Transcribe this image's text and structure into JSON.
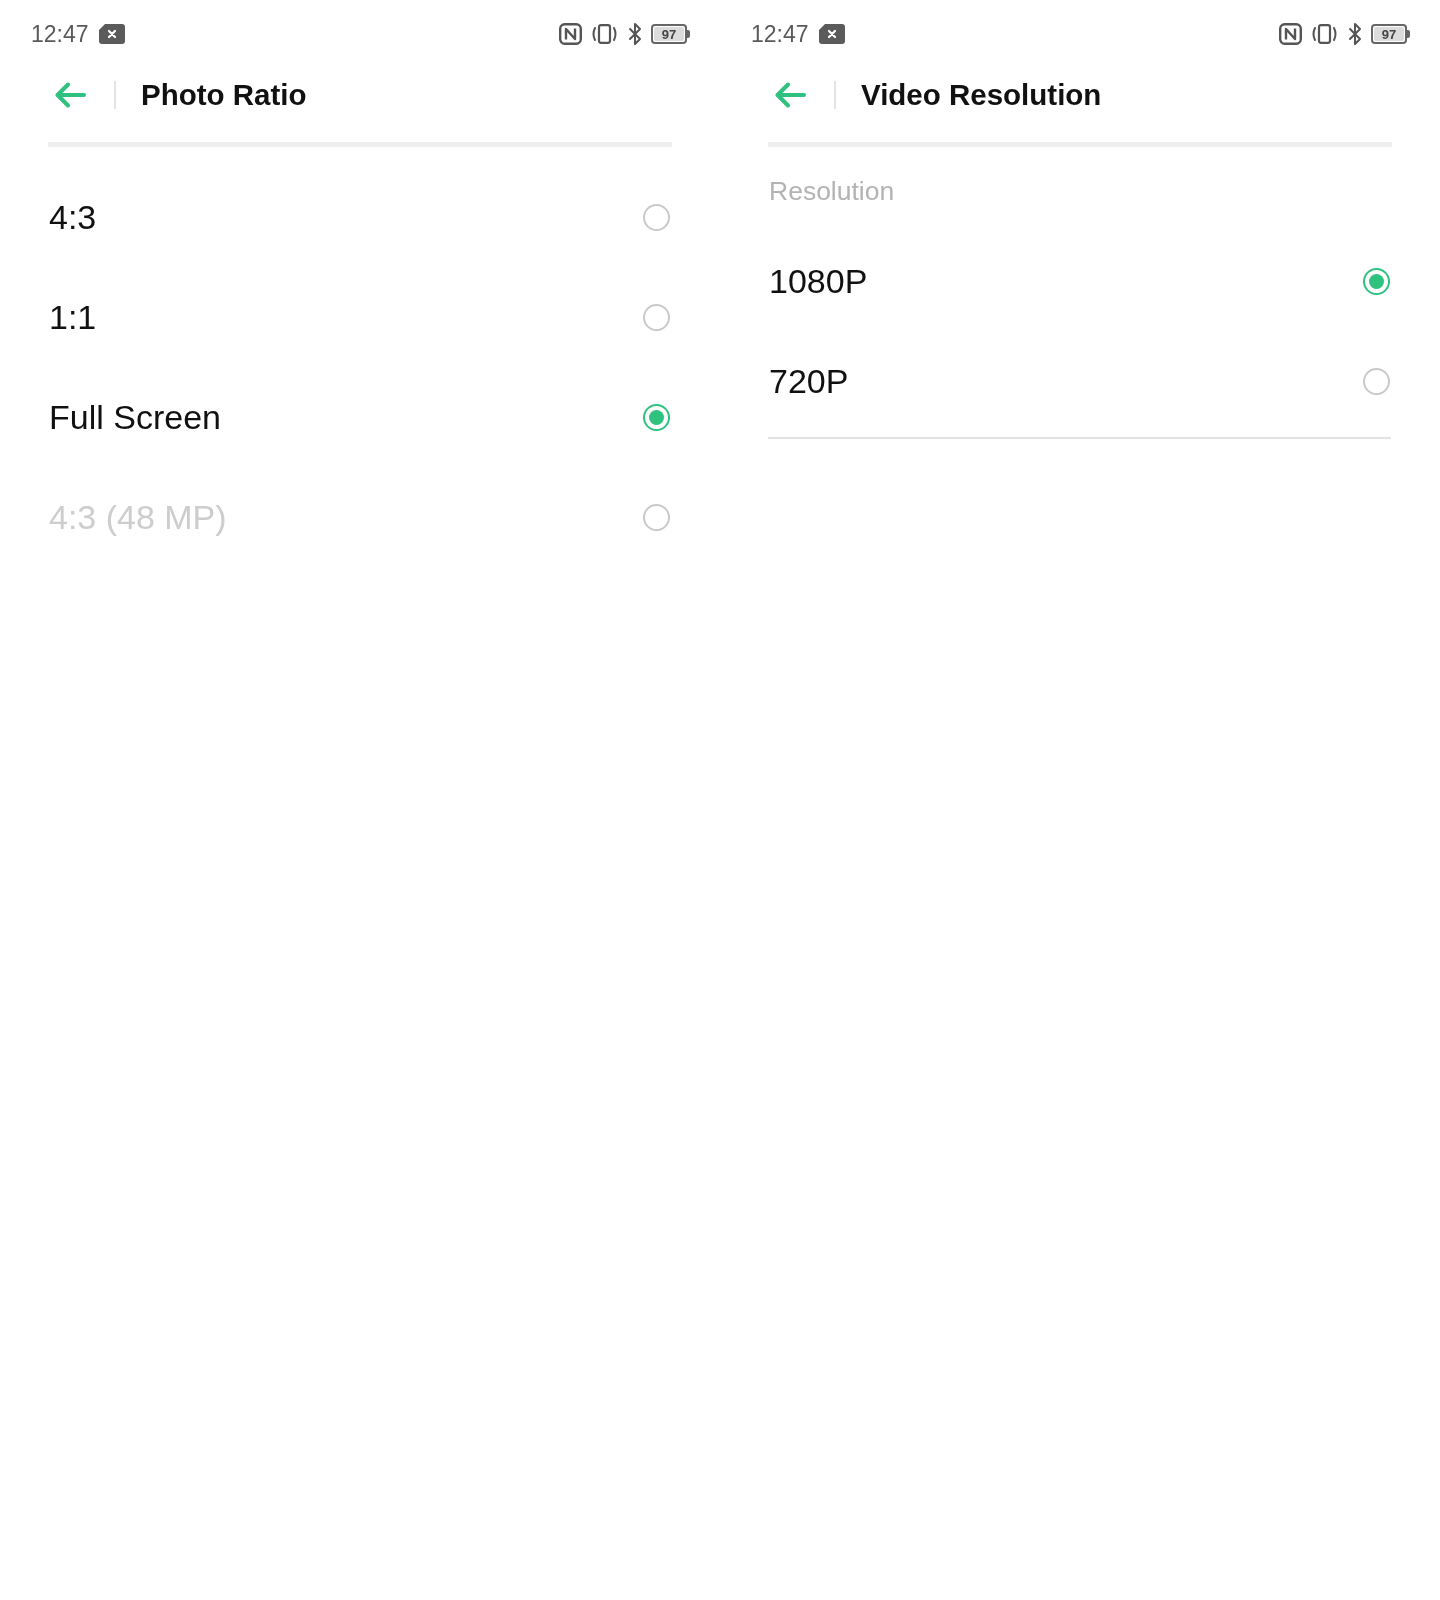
{
  "screens": [
    {
      "status_bar": {
        "time": "12:47",
        "battery": "97"
      },
      "title": "Photo Ratio",
      "options": [
        {
          "label": "4:3",
          "selected": false,
          "disabled": false
        },
        {
          "label": "1:1",
          "selected": false,
          "disabled": false
        },
        {
          "label": "Full Screen",
          "selected": true,
          "disabled": false
        },
        {
          "label": "4:3 (48 MP)",
          "selected": false,
          "disabled": true
        }
      ],
      "bottom_divider": false
    },
    {
      "status_bar": {
        "time": "12:47",
        "battery": "97"
      },
      "title": "Video Resolution",
      "section_label": "Resolution",
      "options": [
        {
          "label": "1080P",
          "selected": true,
          "disabled": false
        },
        {
          "label": "720P",
          "selected": false,
          "disabled": false
        }
      ],
      "bottom_divider": true
    }
  ]
}
